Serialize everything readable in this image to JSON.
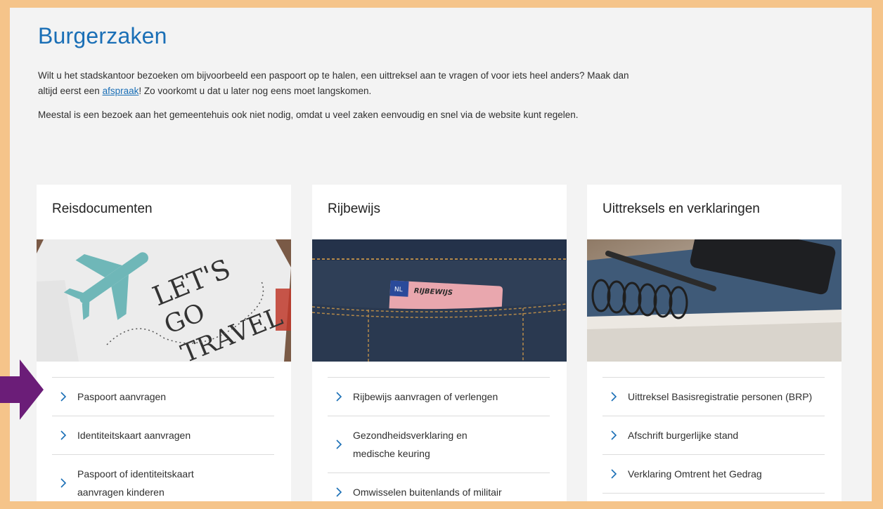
{
  "page": {
    "title": "Burgerzaken",
    "intro_1_before": "Wilt u het stadskantoor bezoeken om bijvoorbeeld een paspoort op te halen, een uittreksel aan te vragen of voor iets heel anders? Maak dan altijd eerst een ",
    "intro_1_link": "afspraak",
    "intro_1_after": "! Zo voorkomt u dat u later nog eens moet langskomen.",
    "intro_2": "Meestal is een bezoek aan het gemeentehuis ook niet nodig, omdat u veel zaken eenvoudig en snel via de website kunt regelen."
  },
  "cards": [
    {
      "title": "Reisdocumenten",
      "image_text": [
        "LET'S",
        "GO",
        "TRAVEL"
      ],
      "items": [
        "Paspoort aanvragen",
        "Identiteitskaart aanvragen",
        "Paspoort of identiteitskaart aanvragen kinderen"
      ]
    },
    {
      "title": "Rijbewijs",
      "image_text": [
        "NL",
        "RIJBEWIJS"
      ],
      "items": [
        "Rijbewijs aanvragen of verlengen",
        "Gezondheidsverklaring en medische keuring",
        "Omwisselen buitenlands of militair"
      ]
    },
    {
      "title": "Uittreksels en verklaringen",
      "items": [
        "Uittreksel Basisregistratie personen (BRP)",
        "Afschrift burgerlijke stand",
        "Verklaring Omtrent het Gedrag"
      ]
    }
  ],
  "colors": {
    "frame": "#f5c48a",
    "heading": "#1a6fb6",
    "link": "#1a6fb6",
    "chevron": "#1a6fb6",
    "pointer_arrow": "#6b1d78"
  },
  "icons": {
    "list_chevron": "chevron-right-icon",
    "pointer": "arrow-right-icon"
  }
}
